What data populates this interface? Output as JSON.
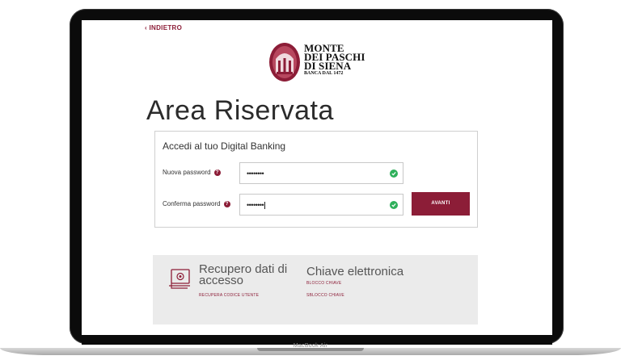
{
  "nav": {
    "back_label": "INDIETRO"
  },
  "logo": {
    "line1": "MONTE",
    "line2": "DEI PASCHI",
    "line3": "DI SIENA",
    "line4": "BANCA DAL 1472"
  },
  "page": {
    "title": "Area Riservata"
  },
  "login": {
    "heading": "Accedi al tuo Digital Banking",
    "new_password_label": "Nuova password",
    "new_password_value": "••••••••",
    "confirm_password_label": "Conferma password",
    "confirm_password_value": "••••••••",
    "help_glyph": "?",
    "submit_label": "AVANTI"
  },
  "recovery": {
    "title": "Recupero dati di accesso",
    "link_user_code": "RECUPERA CODICE UTENTE"
  },
  "chiave": {
    "title": "Chiave elettronica",
    "link_block": "BLOCCO CHIAVE",
    "link_unblock": "SBLOCCO CHIAVE"
  },
  "device": {
    "label": "MacBook Air"
  },
  "colors": {
    "accent": "#8c1d37",
    "success": "#2eb05a",
    "panel": "#ebebeb"
  }
}
